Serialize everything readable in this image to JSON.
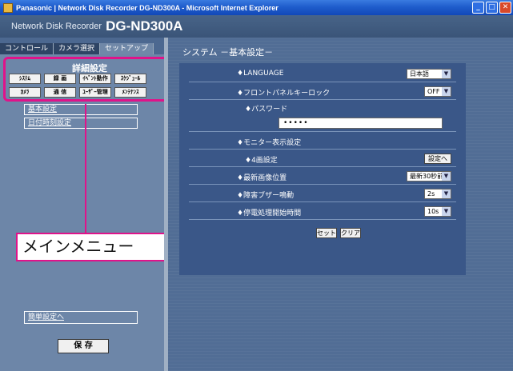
{
  "window": {
    "title": "Panasonic | Network Disk Recorder DG-ND300A - Microsoft Internet Explorer",
    "min_glyph": "_",
    "max_glyph": "□",
    "close_glyph": "✕"
  },
  "header": {
    "product_label": "Network Disk Recorder",
    "model": "DG-ND300A"
  },
  "tabs": [
    {
      "label": "コントロール"
    },
    {
      "label": "カメラ選択"
    },
    {
      "label": "セットアップ"
    }
  ],
  "menu": {
    "title": "詳細設定",
    "buttons": [
      {
        "label": "ｼｽﾃﾑ"
      },
      {
        "label": "録 画"
      },
      {
        "label": "ｲﾍﾞﾝﾄ動作"
      },
      {
        "label": "ｽｹｼﾞｭｰﾙ"
      },
      {
        "label": "ｶﾒﾗ"
      },
      {
        "label": "通 信"
      },
      {
        "label": "ﾕｰｻﾞｰ管理"
      },
      {
        "label": "ﾒﾝﾃﾅﾝｽ"
      }
    ],
    "sublinks": [
      {
        "label": "基本設定"
      },
      {
        "label": "日付時刻設定"
      }
    ],
    "callout": "メインメニュー",
    "easy_setup_link": "簡単設定へ",
    "save_button": "保 存"
  },
  "main": {
    "page_title": "システム －基本設定－",
    "rows": {
      "language": {
        "label": "♦LANGUAGE",
        "value": "日本語"
      },
      "front_lock": {
        "label": "♦フロントパネルキーロック",
        "value": "OFF"
      },
      "password": {
        "label": "♦パスワード",
        "value": "•••••"
      },
      "monitor": {
        "label": "♦モニター表示設定"
      },
      "quad": {
        "label": "♦4画設定",
        "button": "設定へ"
      },
      "latest_pos": {
        "label": "♦最新画像位置",
        "value": "最新30秒前"
      },
      "buzzer": {
        "label": "♦障害ブザー鳴動",
        "value": "2s"
      },
      "power_fail": {
        "label": "♦停電処理開始時間",
        "value": "10s"
      }
    },
    "set_button": "セット",
    "clear_button": "クリア",
    "dropdown_arrow": "▼"
  }
}
